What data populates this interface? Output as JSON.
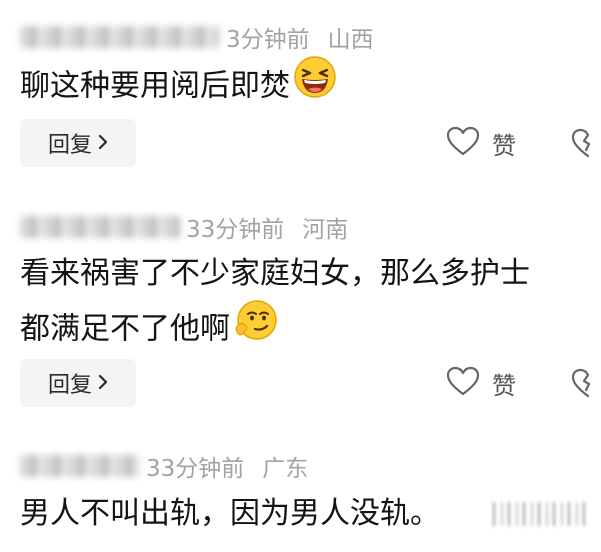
{
  "comments": [
    {
      "time": "3分钟前",
      "location": "山西",
      "text": "聊这种要用阅后即焚",
      "emoji": "laughing-emoji",
      "reply_label": "回复",
      "like_label": "赞"
    },
    {
      "time": "33分钟前",
      "location": "河南",
      "text_line1": "看来祸害了不少家庭妇女，那么多护士",
      "text_line2": "都满足不了他啊",
      "emoji": "smirk-emoji",
      "reply_label": "回复",
      "like_label": "赞"
    },
    {
      "time": "33分钟前",
      "location": "广东",
      "text": "男人不叫出轨，因为男人没轨。"
    }
  ],
  "colors": {
    "meta_text": "#a3a3a3",
    "body_text": "#141414",
    "reply_bg": "#f3f4f6",
    "icon_stroke": "#666666"
  },
  "icons": [
    "chevron-right-icon",
    "heart-icon",
    "broken-heart-icon"
  ]
}
